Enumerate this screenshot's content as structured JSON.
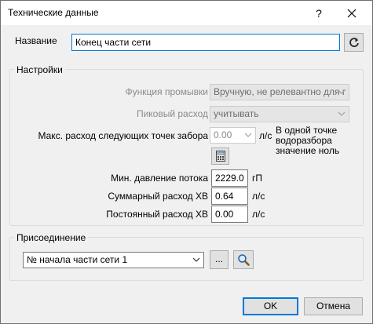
{
  "window": {
    "title": "Технические данные",
    "help_label": "?"
  },
  "name": {
    "label": "Название",
    "value": "Конец части сети"
  },
  "settings": {
    "title": "Настройки",
    "flush_function": {
      "label": "Функция промывки",
      "value": "Вручную, не релевантно для г"
    },
    "peak_flow": {
      "label": "Пиковый расход",
      "value": "учитывать"
    },
    "max_flow_next": {
      "label": "Макс. расход следующих точек забора",
      "value": "0.00",
      "unit": "л/с"
    },
    "note": [
      "В одной точке",
      "водоразбора",
      "значение ноль"
    ],
    "min_pressure": {
      "label": "Мин. давление потока",
      "value": "2229.0",
      "unit": "гП"
    },
    "total_cold_flow": {
      "label": "Суммарный расход ХВ",
      "value": "0.64",
      "unit": "л/с"
    },
    "constant_cold_flow": {
      "label": "Постоянный расход ХВ",
      "value": "0.00",
      "unit": "л/с"
    }
  },
  "connection": {
    "title": "Присоединение",
    "selected": "№ начала части сети 1",
    "browse_label": "..."
  },
  "footer": {
    "ok_label": "OK",
    "cancel_label": "Отмена"
  },
  "colors": {
    "accent": "#0078d7",
    "dialog_bg": "#f0f0f0"
  },
  "icons": [
    "close-icon",
    "refresh-icon",
    "calculator-icon",
    "chevron-down-icon",
    "magnifier-icon"
  ]
}
